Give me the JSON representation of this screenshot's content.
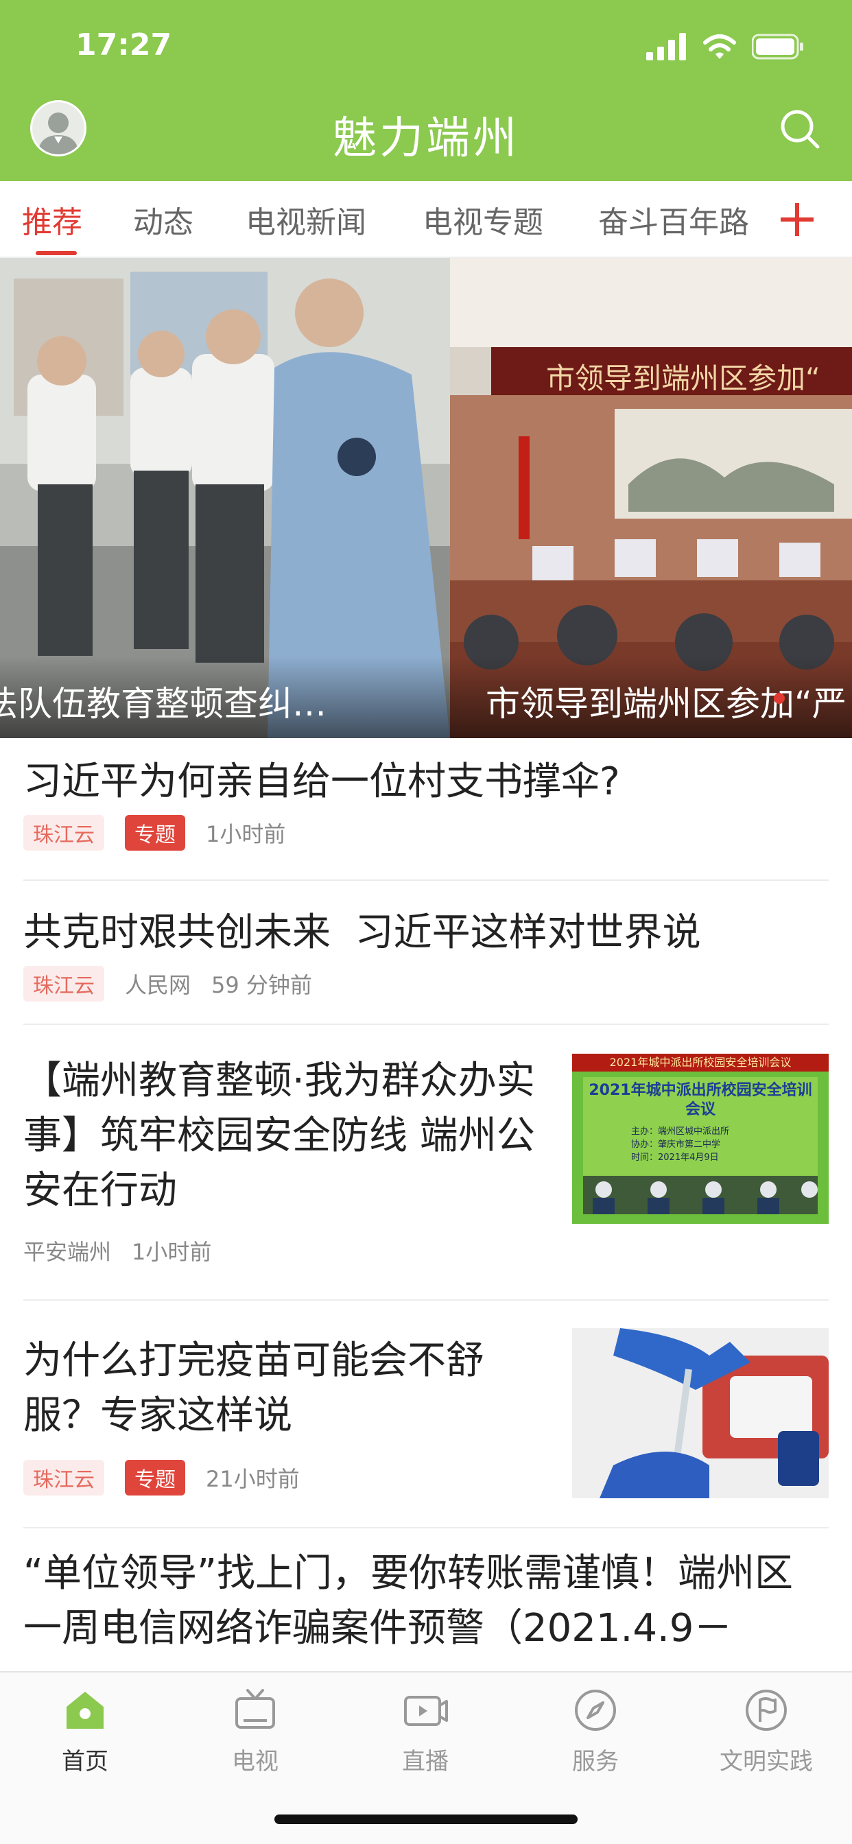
{
  "status_bar": {
    "time": "17:27"
  },
  "header": {
    "title": "魅力端州",
    "accent_color": "#8bc94f"
  },
  "tabs": [
    {
      "label": "推荐",
      "active": true
    },
    {
      "label": "动态"
    },
    {
      "label": "电视新闻"
    },
    {
      "label": "电视专题"
    },
    {
      "label": "奋斗百年路"
    }
  ],
  "banner": {
    "slides": [
      {
        "caption": "法队伍教育整顿查纠…"
      },
      {
        "caption": "市领导到端州区参加“严",
        "sign_text": "市领导到端州区参加“"
      }
    ],
    "dots": 5,
    "active_dot": 0
  },
  "articles": [
    {
      "title": "习近平为何亲自给一位村支书撑伞?",
      "source_tag": "珠江云",
      "topic_tag": "专题",
      "time": "1小时前"
    },
    {
      "title": "共克时艰共创未来  习近平这样对世界说",
      "source_tag": "珠江云",
      "source2": "人民网",
      "time": "59 分钟前"
    },
    {
      "title": "【端州教育整顿·我为群众办实事】筑牢校园安全防线 端州公安在行动",
      "source": "平安端州",
      "time": "1小时前",
      "thumb_banner": "2021年城中派出所校园安全培训会议",
      "thumb_title": "2021年城中派出所校园安全培训会议",
      "thumb_lines": [
        "主办：端州区城中派出所",
        "协办：肇庆市第二中学",
        "时间：2021年4月9日"
      ]
    },
    {
      "title": "为什么打完疫苗可能会不舒服？专家这样说",
      "source_tag": "珠江云",
      "topic_tag": "专题",
      "time": "21小时前"
    },
    {
      "title": "“单位领导”找上门，要你转账需谨慎！端州区一周电信网络诈骗案件预警（2021.4.9－"
    }
  ],
  "tabbar": [
    {
      "label": "首页",
      "icon": "home-icon",
      "active": true
    },
    {
      "label": "电视",
      "icon": "tv-icon"
    },
    {
      "label": "直播",
      "icon": "live-video-icon"
    },
    {
      "label": "服务",
      "icon": "compass-icon"
    },
    {
      "label": "文明实践",
      "icon": "flag-icon"
    }
  ]
}
